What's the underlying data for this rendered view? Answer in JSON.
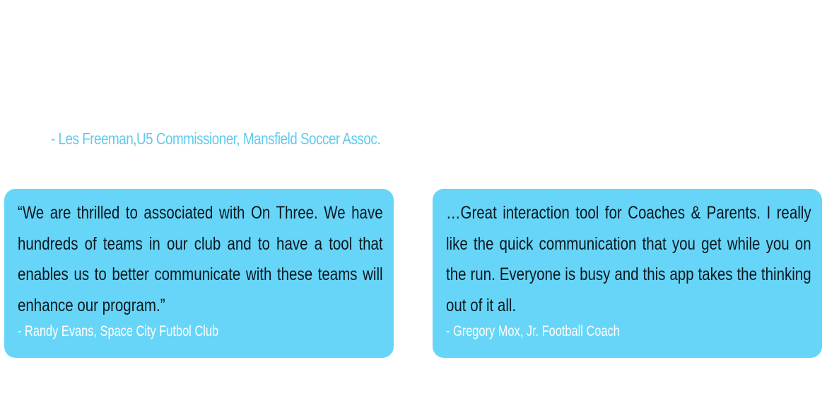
{
  "top_attribution": "- Les Freeman,U5 Commissioner, Mansfield Soccer Assoc.",
  "testimonials": [
    {
      "quote": "“We are thrilled to associated with On Three. We have hundreds of teams in our club and to have a tool that enables us to better communicate with these teams will enhance our program.”",
      "author": "- Randy Evans, Space City Futbol Club"
    },
    {
      "quote": "…Great interaction tool for Coaches & Parents. I really like the quick communication that you get while you on the run. Everyone is busy and this app takes the thinking out of it all.",
      "author": "- Gregory Mox, Jr. Football Coach"
    }
  ],
  "colors": {
    "card_background": "#67d5f7",
    "accent_text": "#5fcbec",
    "quote_text": "#0c1820",
    "author_text": "#ffffff"
  }
}
